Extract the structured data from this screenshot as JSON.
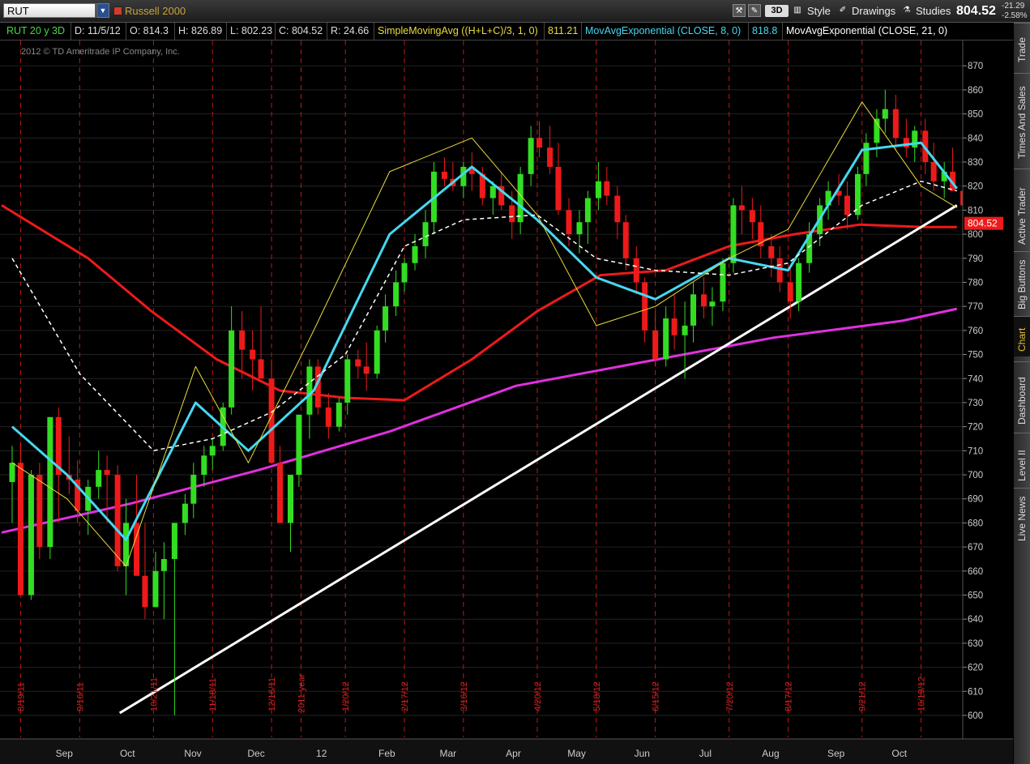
{
  "toolbar": {
    "symbol": "RUT",
    "description": "Russell 2000",
    "btn_3d": "3D",
    "style_label": "Style",
    "drawings_label": "Drawings",
    "studies_label": "Studies",
    "last_price": "804.52",
    "change_abs": "-21.29",
    "change_pct": "-2.58%"
  },
  "info": {
    "symbol_period": "RUT 20 y 3D",
    "date": "D: 11/5/12",
    "open": "O: 814.3",
    "high": "H: 826.89",
    "low": "L: 802.23",
    "close": "C: 804.52",
    "range": "R: 24.66",
    "sma_label": "SimpleMovingAvg ((H+L+C)/3, 1, 0)",
    "sma_value": "811.21",
    "ema8_label": "MovAvgExponential (CLOSE, 8, 0)",
    "ema8_value": "818.8",
    "ema21_label": "MovAvgExponential (CLOSE, 21, 0)"
  },
  "side_tabs": [
    "Trade",
    "Times And Sales",
    "Active Trader",
    "Big Buttons",
    "Chart",
    "Dashboard",
    "Level II",
    "Live News"
  ],
  "colors": {
    "up": "#33dd22",
    "down": "#ee1a1a",
    "ema8": "#45d8f0",
    "sma_hlc3": "#e8dd3a",
    "ema21": "#ffffff",
    "long_ma": "#ee1a1a",
    "long_ma2": "#e030e0",
    "trendline": "#ffffff",
    "grid": "#bb1a1a",
    "price_tag": "#ee1a1a"
  },
  "chart_data": {
    "type": "candlestick",
    "title": "Russell 2000",
    "copyright": "2012 © TD Ameritrade IP Company, Inc.",
    "ylim": [
      595,
      875
    ],
    "yticks": [
      600,
      610,
      620,
      630,
      640,
      650,
      660,
      670,
      680,
      690,
      700,
      710,
      720,
      730,
      740,
      750,
      760,
      770,
      780,
      790,
      800,
      810,
      820,
      830,
      840,
      850,
      860,
      870
    ],
    "last_price_tag": "804.52",
    "months": [
      "Sep",
      "Oct",
      "Nov",
      "Dec",
      "12",
      "Feb",
      "Mar",
      "Apr",
      "May",
      "Jun",
      "Jul",
      "Aug",
      "Sep",
      "Oct"
    ],
    "month_dates": [
      "2011-09-01",
      "2011-10-01",
      "2011-11-01",
      "2011-12-01",
      "2012-01-01",
      "2012-02-01",
      "2012-03-01",
      "2012-04-01",
      "2012-05-01",
      "2012-06-01",
      "2012-07-01",
      "2012-08-01",
      "2012-09-01",
      "2012-10-01"
    ],
    "vlines": [
      {
        "date": "2011-08-19",
        "label": "8/19/11"
      },
      {
        "date": "2011-09-16",
        "label": "9/16/11"
      },
      {
        "date": "2011-10-21",
        "label": "10/21/11"
      },
      {
        "date": "2011-11-18",
        "label": "11/18/11"
      },
      {
        "date": "2011-12-16",
        "label": "12/16/11"
      },
      {
        "date": "2011-12-30",
        "label": "2011 year"
      },
      {
        "date": "2012-01-20",
        "label": "1/20/12"
      },
      {
        "date": "2012-02-17",
        "label": "2/17/12"
      },
      {
        "date": "2012-03-16",
        "label": "3/16/12"
      },
      {
        "date": "2012-04-20",
        "label": "4/20/12"
      },
      {
        "date": "2012-05-18",
        "label": "5/18/12"
      },
      {
        "date": "2012-06-15",
        "label": "6/15/12"
      },
      {
        "date": "2012-07-20",
        "label": "7/20/12"
      },
      {
        "date": "2012-08-17",
        "label": "8/17/12"
      },
      {
        "date": "2012-09-21",
        "label": "9/21/12"
      },
      {
        "date": "2012-10-19",
        "label": "10/19/12"
      }
    ],
    "candles_start_date": "2011-08-15",
    "candle_period_days": 3,
    "candles": [
      [
        697,
        712,
        680,
        705
      ],
      [
        705,
        713,
        665,
        650
      ],
      [
        650,
        702,
        648,
        700
      ],
      [
        700,
        705,
        665,
        670
      ],
      [
        670,
        690,
        665,
        724
      ],
      [
        724,
        728,
        680,
        700
      ],
      [
        700,
        716,
        692,
        698
      ],
      [
        698,
        706,
        680,
        685
      ],
      [
        685,
        698,
        675,
        695
      ],
      [
        695,
        710,
        690,
        702
      ],
      [
        702,
        708,
        680,
        700
      ],
      [
        700,
        704,
        660,
        662
      ],
      [
        662,
        690,
        650,
        680
      ],
      [
        680,
        700,
        670,
        658
      ],
      [
        658,
        680,
        640,
        645
      ],
      [
        645,
        668,
        648,
        660
      ],
      [
        660,
        672,
        640,
        665
      ],
      [
        665,
        678,
        600,
        680
      ],
      [
        680,
        692,
        675,
        688
      ],
      [
        688,
        705,
        682,
        700
      ],
      [
        700,
        712,
        695,
        708
      ],
      [
        708,
        715,
        702,
        712
      ],
      [
        712,
        730,
        710,
        728
      ],
      [
        728,
        770,
        725,
        760
      ],
      [
        760,
        768,
        740,
        752
      ],
      [
        752,
        760,
        735,
        748
      ],
      [
        748,
        770,
        745,
        740
      ],
      [
        740,
        748,
        712,
        705
      ],
      [
        705,
        712,
        686,
        680
      ],
      [
        680,
        700,
        668,
        700
      ],
      [
        700,
        725,
        695,
        725
      ],
      [
        725,
        748,
        715,
        745
      ],
      [
        745,
        748,
        725,
        728
      ],
      [
        728,
        734,
        715,
        720
      ],
      [
        720,
        732,
        718,
        730
      ],
      [
        730,
        750,
        725,
        748
      ],
      [
        748,
        752,
        740,
        745
      ],
      [
        745,
        755,
        735,
        742
      ],
      [
        742,
        762,
        740,
        760
      ],
      [
        760,
        775,
        755,
        770
      ],
      [
        770,
        785,
        766,
        780
      ],
      [
        780,
        790,
        776,
        788
      ],
      [
        788,
        800,
        785,
        795
      ],
      [
        795,
        810,
        790,
        805
      ],
      [
        805,
        830,
        800,
        826
      ],
      [
        826,
        832,
        820,
        823
      ],
      [
        823,
        830,
        818,
        820
      ],
      [
        820,
        830,
        815,
        828
      ],
      [
        828,
        834,
        818,
        825
      ],
      [
        825,
        828,
        812,
        815
      ],
      [
        815,
        822,
        808,
        820
      ],
      [
        820,
        826,
        810,
        812
      ],
      [
        812,
        818,
        798,
        805
      ],
      [
        805,
        828,
        800,
        825
      ],
      [
        825,
        845,
        820,
        840
      ],
      [
        840,
        847,
        832,
        836
      ],
      [
        836,
        845,
        825,
        828
      ],
      [
        828,
        838,
        808,
        810
      ],
      [
        810,
        815,
        795,
        800
      ],
      [
        800,
        810,
        792,
        805
      ],
      [
        805,
        818,
        796,
        815
      ],
      [
        815,
        830,
        810,
        822
      ],
      [
        822,
        828,
        812,
        816
      ],
      [
        816,
        820,
        798,
        805
      ],
      [
        805,
        808,
        785,
        790
      ],
      [
        790,
        795,
        775,
        780
      ],
      [
        780,
        782,
        755,
        760
      ],
      [
        760,
        768,
        745,
        748
      ],
      [
        748,
        770,
        745,
        765
      ],
      [
        765,
        775,
        752,
        758
      ],
      [
        758,
        772,
        740,
        762
      ],
      [
        762,
        780,
        755,
        775
      ],
      [
        775,
        782,
        765,
        770
      ],
      [
        770,
        778,
        762,
        772
      ],
      [
        772,
        790,
        768,
        788
      ],
      [
        788,
        815,
        784,
        812
      ],
      [
        812,
        820,
        800,
        810
      ],
      [
        810,
        815,
        798,
        805
      ],
      [
        805,
        812,
        790,
        795
      ],
      [
        795,
        800,
        782,
        790
      ],
      [
        790,
        795,
        776,
        780
      ],
      [
        780,
        786,
        765,
        772
      ],
      [
        772,
        790,
        768,
        788
      ],
      [
        788,
        805,
        784,
        800
      ],
      [
        800,
        815,
        795,
        812
      ],
      [
        812,
        822,
        806,
        818
      ],
      [
        818,
        825,
        812,
        816
      ],
      [
        816,
        822,
        802,
        808
      ],
      [
        808,
        828,
        806,
        825
      ],
      [
        825,
        842,
        820,
        838
      ],
      [
        838,
        852,
        832,
        848
      ],
      [
        848,
        860,
        842,
        852
      ],
      [
        852,
        858,
        835,
        840
      ],
      [
        840,
        848,
        832,
        836
      ],
      [
        836,
        845,
        830,
        843
      ],
      [
        843,
        848,
        825,
        830
      ],
      [
        830,
        838,
        818,
        822
      ],
      [
        822,
        830,
        815,
        826
      ],
      [
        826,
        836,
        818,
        818
      ],
      [
        818,
        822,
        808,
        812
      ],
      [
        812,
        818,
        805,
        814
      ],
      [
        814,
        827,
        802,
        805
      ]
    ],
    "series": [
      {
        "name": "MovAvgExponential (CLOSE, 8, 0)",
        "color": "ema8",
        "x_dates": [
          "2011-08-15",
          "2011-09-10",
          "2011-10-08",
          "2011-11-10",
          "2011-12-05",
          "2012-01-05",
          "2012-02-10",
          "2012-03-20",
          "2012-04-20",
          "2012-05-18",
          "2012-06-15",
          "2012-07-20",
          "2012-08-17",
          "2012-09-21",
          "2012-10-19",
          "2012-11-05"
        ],
        "values": [
          720,
          700,
          673,
          730,
          710,
          735,
          800,
          828,
          806,
          782,
          773,
          790,
          785,
          835,
          838,
          819
        ]
      },
      {
        "name": "MovAvgExponential (CLOSE, 21, 0)",
        "color": "ema21",
        "dashed": true,
        "x_dates": [
          "2011-08-15",
          "2011-09-16",
          "2011-10-21",
          "2011-11-18",
          "2011-12-16",
          "2012-01-20",
          "2012-02-17",
          "2012-03-16",
          "2012-04-20",
          "2012-05-18",
          "2012-06-15",
          "2012-07-20",
          "2012-08-17",
          "2012-09-21",
          "2012-10-19",
          "2012-11-05"
        ],
        "values": [
          790,
          742,
          710,
          715,
          726,
          750,
          795,
          806,
          808,
          790,
          785,
          783,
          788,
          812,
          822,
          818
        ]
      },
      {
        "name": "SimpleMovingAvg ((H+L+C)/3, 1, 0)",
        "color": "sma_hlc3",
        "x_dates": [
          "2011-08-15",
          "2011-09-10",
          "2011-10-08",
          "2011-11-10",
          "2011-12-05",
          "2012-01-05",
          "2012-02-10",
          "2012-03-20",
          "2012-04-20",
          "2012-05-18",
          "2012-06-15",
          "2012-07-20",
          "2012-08-17",
          "2012-09-21",
          "2012-10-19",
          "2012-11-05"
        ],
        "values": [
          705,
          690,
          662,
          745,
          705,
          760,
          826,
          840,
          808,
          762,
          770,
          790,
          802,
          855,
          820,
          811
        ]
      },
      {
        "name": "",
        "color": "long_ma",
        "x_dates": [
          "2011-08-10",
          "2011-09-20",
          "2011-10-20",
          "2011-11-20",
          "2011-12-20",
          "2012-01-20",
          "2012-02-17",
          "2012-03-20",
          "2012-04-20",
          "2012-05-20",
          "2012-06-20",
          "2012-07-20",
          "2012-08-20",
          "2012-09-20",
          "2012-10-20",
          "2012-11-05"
        ],
        "values": [
          812,
          790,
          768,
          748,
          735,
          732,
          731,
          748,
          768,
          783,
          785,
          795,
          800,
          804,
          803,
          803
        ]
      },
      {
        "name": "",
        "color": "long_ma2",
        "x_dates": [
          "2011-08-10",
          "2011-10-10",
          "2011-12-10",
          "2012-02-10",
          "2012-04-10",
          "2012-06-10",
          "2012-08-10",
          "2012-10-10",
          "2012-11-05"
        ],
        "values": [
          676,
          688,
          702,
          718,
          737,
          747,
          757,
          764,
          769
        ]
      }
    ],
    "trendline": {
      "start_date": "2011-10-05",
      "start_value": 601,
      "end_date": "2012-11-05",
      "end_value": 812
    }
  }
}
